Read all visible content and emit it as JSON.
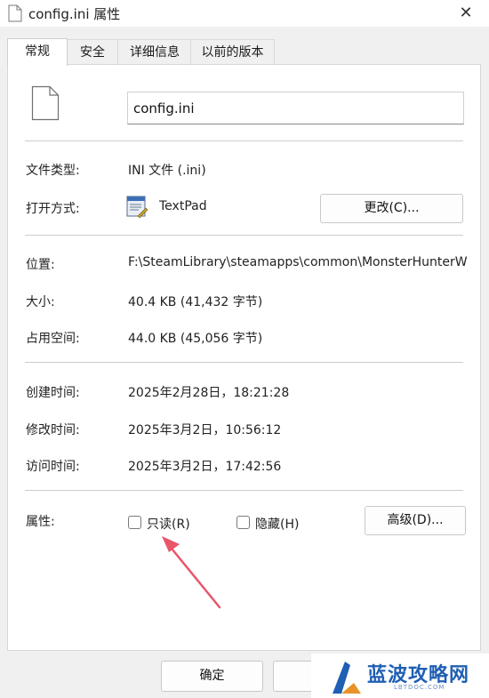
{
  "window": {
    "title": "config.ini 属性",
    "close_symbol": "✕"
  },
  "tabs": [
    {
      "label": "常规",
      "active": true
    },
    {
      "label": "安全",
      "active": false
    },
    {
      "label": "详细信息",
      "active": false
    },
    {
      "label": "以前的版本",
      "active": false
    }
  ],
  "general": {
    "file_name": "config.ini",
    "file_type_label": "文件类型:",
    "file_type_value": "INI 文件 (.ini)",
    "open_with_label": "打开方式:",
    "open_with_app": "TextPad",
    "change_button": "更改(C)...",
    "location_label": "位置:",
    "location_value": "F:\\SteamLibrary\\steamapps\\common\\MonsterHunterWilds",
    "size_label": "大小:",
    "size_value": "40.4 KB (41,432 字节)",
    "disk_size_label": "占用空间:",
    "disk_size_value": "44.0 KB (45,056 字节)",
    "created_label": "创建时间:",
    "created_value": "2025年2月28日，18:21:28",
    "modified_label": "修改时间:",
    "modified_value": "2025年3月2日，10:56:12",
    "accessed_label": "访问时间:",
    "accessed_value": "2025年3月2日，17:42:56",
    "attributes_label": "属性:",
    "readonly_label": "只读(R)",
    "readonly_checked": false,
    "hidden_label": "隐藏(H)",
    "hidden_checked": false,
    "advanced_button": "高级(D)..."
  },
  "footer": {
    "ok_button": "确定",
    "cancel_button": ""
  },
  "watermark": {
    "name": "蓝波攻略网",
    "domain": "LBTDOC.COM"
  },
  "colors": {
    "arrow": "#e8566a",
    "watermark": "#1f5fb4"
  }
}
